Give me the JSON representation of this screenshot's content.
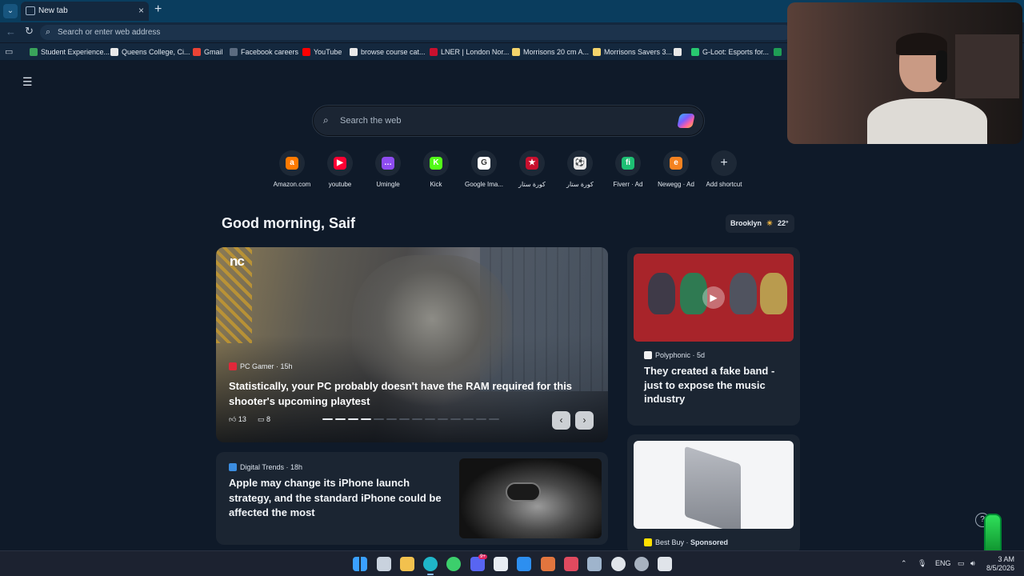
{
  "browser": {
    "tab_title": "New tab",
    "address_placeholder": "Search or enter web address",
    "bookmarks": [
      {
        "label": "Student Experience...",
        "color": "#3aa35b"
      },
      {
        "label": "Queens College, Ci...",
        "color": "#e8e8e8"
      },
      {
        "label": "Gmail",
        "color": "#ea4335"
      },
      {
        "label": "Facebook careers",
        "color": "#5b6b80"
      },
      {
        "label": "YouTube",
        "color": "#ff0000"
      },
      {
        "label": "browse course cat...",
        "color": "#e8e8e8"
      },
      {
        "label": "LNER | London Nor...",
        "color": "#c8102e"
      },
      {
        "label": "Morrisons 20 cm A...",
        "color": "#f3d36b"
      },
      {
        "label": "Morrisons Savers 3...",
        "color": "#f3d36b"
      },
      {
        "label": "",
        "color": "#e8e8e8"
      },
      {
        "label": "G-Loot: Esports for...",
        "color": "#28c76f"
      },
      {
        "label": "",
        "color": "#1f9d55"
      }
    ]
  },
  "page": {
    "search_placeholder": "Search the web",
    "greeting": "Good morning, Saif",
    "weather": {
      "city": "Brooklyn",
      "temp": "22°"
    },
    "shortcuts": [
      {
        "label": "Amazon.com",
        "color": "#ff7a00",
        "glyph": "a"
      },
      {
        "label": "youtube",
        "color": "#ff0033",
        "glyph": "▶"
      },
      {
        "label": "Umingle",
        "color": "#8e4cf0",
        "glyph": "…"
      },
      {
        "label": "Kick",
        "color": "#53fc18",
        "glyph": "K"
      },
      {
        "label": "Google Ima...",
        "color": "#ffffff",
        "glyph": "G"
      },
      {
        "label": "كورة ستار",
        "color": "#c8102e",
        "glyph": "★"
      },
      {
        "label": "كورة ستار",
        "color": "#e8e8e8",
        "glyph": "⚽"
      },
      {
        "label": "Fiverr · Ad",
        "color": "#1dbf73",
        "glyph": "fi"
      },
      {
        "label": "Newegg · Ad",
        "color": "#f58220",
        "glyph": "e"
      },
      {
        "label": "Add shortcut",
        "color": "transparent",
        "glyph": "+"
      }
    ]
  },
  "hero": {
    "logo_text": "nc",
    "source": "PC Gamer",
    "age": "15h",
    "title": "Statistically, your PC probably doesn't have the RAM required for this shooter's upcoming playtest",
    "likes": "13",
    "comments": "8",
    "active_slide": 4,
    "slide_count": 14
  },
  "card_polyphonic": {
    "source": "Polyphonic",
    "age": "5d",
    "title": "They created a fake band - just to expose the music industry"
  },
  "card_digitaltrends": {
    "source": "Digital Trends",
    "age": "18h",
    "title": "Apple may change its iPhone launch strategy, and the standard iPhone could be affected the most"
  },
  "card_bestbuy": {
    "source": "Best Buy",
    "sponsored": "Sponsored"
  },
  "taskbar": {
    "lang": "ENG",
    "time": "3 AM",
    "date": "8/5/2026",
    "discord_badge": "9+"
  }
}
